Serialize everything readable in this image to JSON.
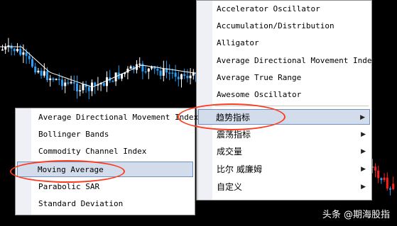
{
  "theme": {
    "chart_bg": "#000000",
    "candle_blue": "#2a9df4",
    "candle_white": "#ffffff",
    "candle_red": "#ff2020",
    "ma_line": "#ffffff",
    "menu_bg": "#ffffff",
    "menu_highlight": "#d3dcea",
    "annotation_red": "#ff3b1f"
  },
  "indicator_menu": {
    "items": [
      {
        "label": "Accelerator Oscillator",
        "has_submenu": false
      },
      {
        "label": "Accumulation/Distribution",
        "has_submenu": false
      },
      {
        "label": "Alligator",
        "has_submenu": false
      },
      {
        "label": "Average Directional Movement Index",
        "has_submenu": false
      },
      {
        "label": "Average True Range",
        "has_submenu": false
      },
      {
        "label": "Awesome Oscillator",
        "has_submenu": false
      },
      {
        "label": "趋势指标",
        "has_submenu": true,
        "highlighted": true
      },
      {
        "label": "震荡指标",
        "has_submenu": true
      },
      {
        "label": "成交量",
        "has_submenu": true
      },
      {
        "label": "比尔 威廉姆",
        "has_submenu": true
      },
      {
        "label": "自定义",
        "has_submenu": true
      }
    ],
    "submenu_arrow": "▶"
  },
  "trend_submenu": {
    "items": [
      {
        "label": "Average Directional Movement Index"
      },
      {
        "label": "Bollinger Bands"
      },
      {
        "label": "Commodity Channel Index"
      },
      {
        "label": "Moving Average",
        "highlighted": true
      },
      {
        "label": "Parabolic SAR"
      },
      {
        "label": "Standard Deviation"
      }
    ]
  },
  "watermark": "头条 @期海股指"
}
